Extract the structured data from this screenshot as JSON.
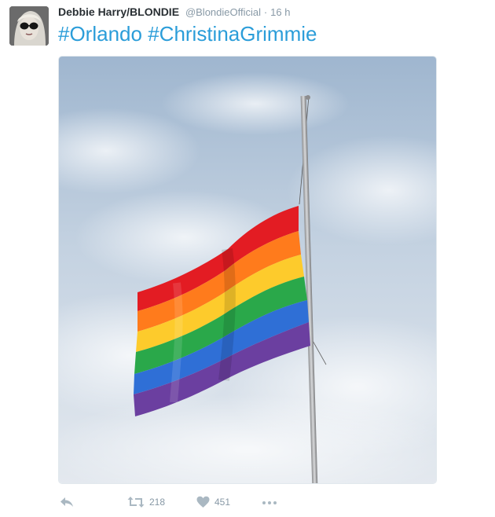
{
  "tweet": {
    "author": {
      "name": "Debbie Harry/BLONDIE",
      "handle": "@BlondieOfficial",
      "separator": "·",
      "time": "16 h",
      "avatar_icon": "profile-avatar"
    },
    "hashtags": [
      "#Orlando",
      "#ChristinaGrimmie"
    ],
    "media": {
      "subject_icon": "rainbow-flag-half-mast-photo",
      "flag_colors": [
        "#e31c23",
        "#ff7b1c",
        "#fdcb2c",
        "#2aa84a",
        "#2f6fd6",
        "#6b3fa0"
      ],
      "sky_colors": [
        "#9fb6cf",
        "#c4d2e1",
        "#e4e9ef"
      ]
    },
    "actions": {
      "reply_icon": "reply-icon",
      "retweet_icon": "retweet-icon",
      "retweet_count": "218",
      "like_icon": "heart-icon",
      "like_count": "451",
      "more_icon": "more-icon"
    },
    "colors": {
      "link": "#2b9dd9",
      "name": "#292f33",
      "meta": "#8899a6",
      "icon": "#aab8c2"
    }
  }
}
